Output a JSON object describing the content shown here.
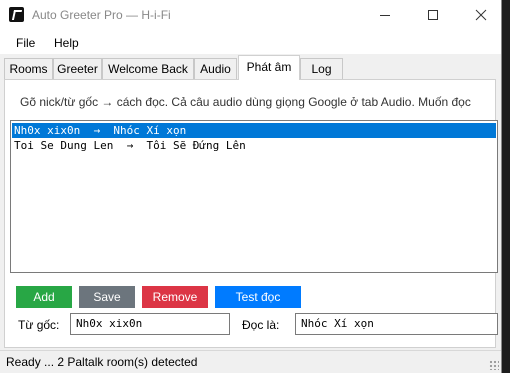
{
  "window": {
    "title": "Auto Greeter Pro — H-i-Fi"
  },
  "menu": {
    "file": "File",
    "help": "Help"
  },
  "tabs": [
    {
      "label": "Rooms"
    },
    {
      "label": "Greeter"
    },
    {
      "label": "Welcome Back"
    },
    {
      "label": "Audio"
    },
    {
      "label": "Phát âm",
      "active": true
    },
    {
      "label": "Log"
    }
  ],
  "pronounce": {
    "hint": "Gõ nick/từ gốc → cách đọc. Cả câu audio dùng giọng Google ở tab Audio. Muốn đọc",
    "entries": [
      {
        "text": "Nh0x xix0n  →  Nhóc Xí xọn",
        "selected": true
      },
      {
        "text": "Toi Se Dung Len  →  Tôi Sẽ Đứng Lên",
        "selected": false
      }
    ],
    "buttons": {
      "add": "Add",
      "save": "Save",
      "remove": "Remove",
      "test": "Test đọc"
    },
    "source_label": "Từ gốc:",
    "source_value": "Nh0x xix0n",
    "read_label": "Đọc là:",
    "read_value": "Nhóc Xí xọn",
    "colors": {
      "add": "#28a745",
      "save": "#6c757d",
      "remove": "#dc3545",
      "test": "#007bff",
      "selection": "#0078d7"
    }
  },
  "status": {
    "text": "Ready ... 2 Paltalk room(s) detected"
  }
}
